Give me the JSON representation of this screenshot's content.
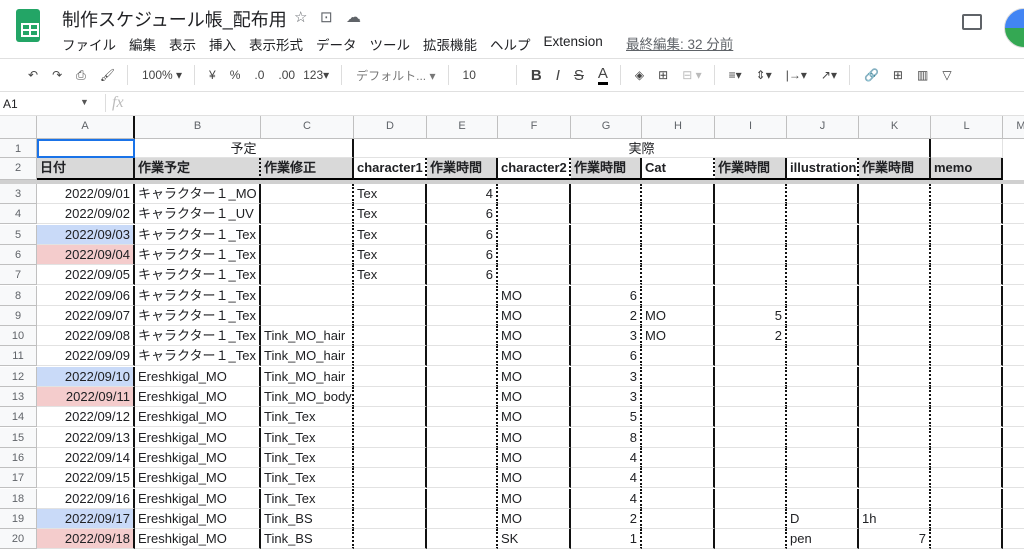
{
  "app": {
    "title": "制作スケジュール帳_配布用",
    "last_edit": "最終編集: 32 分前"
  },
  "menu": [
    "ファイル",
    "編集",
    "表示",
    "挿入",
    "表示形式",
    "データ",
    "ツール",
    "拡張機能",
    "ヘルプ",
    "Extension"
  ],
  "toolbar": {
    "zoom": "100%",
    "currency": "¥",
    "percent": "%",
    "dec_less": ".0",
    "dec_more": ".00",
    "format": "123▾",
    "font": "デフォルト...",
    "font_size": "10"
  },
  "formula_bar": {
    "cell_ref": "A1",
    "fx": "fx",
    "value": ""
  },
  "columns": [
    "A",
    "B",
    "C",
    "D",
    "E",
    "F",
    "G",
    "H",
    "I",
    "J",
    "K",
    "L",
    "M"
  ],
  "row1": {
    "planned": "予定",
    "actual": "実際"
  },
  "headers": [
    "日付",
    "作業予定",
    "作業修正",
    "character1",
    "作業時間",
    "character2",
    "作業時間",
    "Cat",
    "作業時間",
    "illustration",
    "作業時間",
    "memo"
  ],
  "rows": [
    [
      "3",
      "2022/09/01",
      "キャラクター１_MO",
      "",
      "Tex",
      "4",
      "",
      "",
      "",
      "",
      "",
      "",
      ""
    ],
    [
      "4",
      "2022/09/02",
      "キャラクター１_UV",
      "",
      "Tex",
      "6",
      "",
      "",
      "",
      "",
      "",
      "",
      ""
    ],
    [
      "5",
      "2022/09/03",
      "キャラクター１_Tex",
      "",
      "Tex",
      "6",
      "",
      "",
      "",
      "",
      "",
      "",
      ""
    ],
    [
      "6",
      "2022/09/04",
      "キャラクター１_Tex",
      "",
      "Tex",
      "6",
      "",
      "",
      "",
      "",
      "",
      "",
      ""
    ],
    [
      "7",
      "2022/09/05",
      "キャラクター１_Tex",
      "",
      "Tex",
      "6",
      "",
      "",
      "",
      "",
      "",
      "",
      ""
    ],
    [
      "8",
      "2022/09/06",
      "キャラクター１_Tex",
      "",
      "",
      "",
      "MO",
      "6",
      "",
      "",
      "",
      "",
      ""
    ],
    [
      "9",
      "2022/09/07",
      "キャラクター１_Tex",
      "",
      "",
      "",
      "MO",
      "2",
      "MO",
      "5",
      "",
      "",
      ""
    ],
    [
      "10",
      "2022/09/08",
      "キャラクター１_Tex",
      "Tink_MO_hair",
      "",
      "",
      "MO",
      "3",
      "MO",
      "2",
      "",
      "",
      ""
    ],
    [
      "11",
      "2022/09/09",
      "キャラクター１_Tex",
      "Tink_MO_hair",
      "",
      "",
      "MO",
      "6",
      "",
      "",
      "",
      "",
      ""
    ],
    [
      "12",
      "2022/09/10",
      "Ereshkigal_MO",
      "Tink_MO_hair",
      "",
      "",
      "MO",
      "3",
      "",
      "",
      "",
      "",
      ""
    ],
    [
      "13",
      "2022/09/11",
      "Ereshkigal_MO",
      "Tink_MO_body",
      "",
      "",
      "MO",
      "3",
      "",
      "",
      "",
      "",
      ""
    ],
    [
      "14",
      "2022/09/12",
      "Ereshkigal_MO",
      "Tink_Tex",
      "",
      "",
      "MO",
      "5",
      "",
      "",
      "",
      "",
      ""
    ],
    [
      "15",
      "2022/09/13",
      "Ereshkigal_MO",
      "Tink_Tex",
      "",
      "",
      "MO",
      "8",
      "",
      "",
      "",
      "",
      ""
    ],
    [
      "16",
      "2022/09/14",
      "Ereshkigal_MO",
      "Tink_Tex",
      "",
      "",
      "MO",
      "4",
      "",
      "",
      "",
      "",
      ""
    ],
    [
      "17",
      "2022/09/15",
      "Ereshkigal_MO",
      "Tink_Tex",
      "",
      "",
      "MO",
      "4",
      "",
      "",
      "",
      "",
      ""
    ],
    [
      "18",
      "2022/09/16",
      "Ereshkigal_MO",
      "Tink_Tex",
      "",
      "",
      "MO",
      "4",
      "",
      "",
      "",
      "",
      ""
    ],
    [
      "19",
      "2022/09/17",
      "Ereshkigal_MO",
      "Tink_BS",
      "",
      "",
      "MO",
      "2",
      "",
      "",
      "D",
      "1h",
      ""
    ],
    [
      "20",
      "2022/09/18",
      "Ereshkigal_MO",
      "Tink_BS",
      "",
      "",
      "SK",
      "1",
      "",
      "",
      "pen",
      "7",
      ""
    ]
  ],
  "colors": {
    "saturday": "#c9daf8",
    "sunday": "#f4cccc",
    "header": "#d9d9d9"
  }
}
